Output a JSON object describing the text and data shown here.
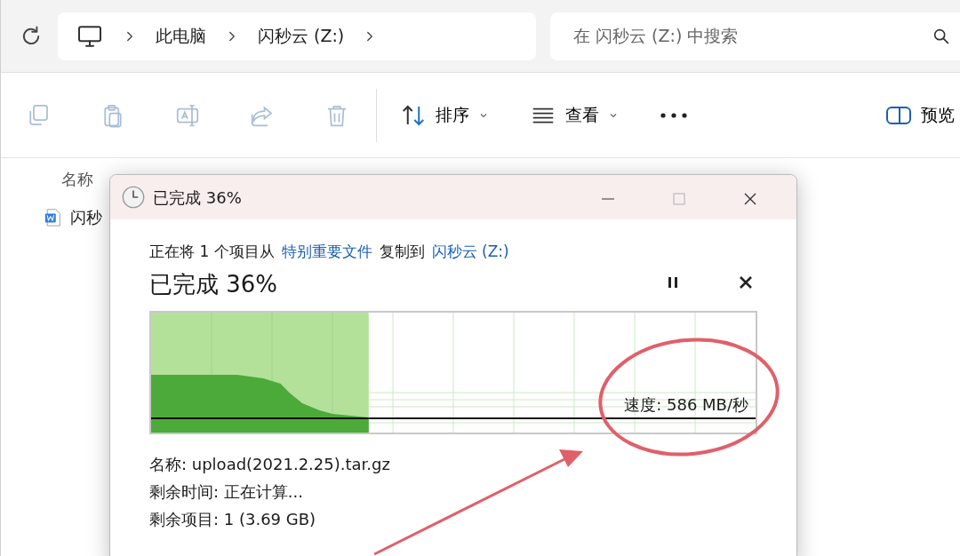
{
  "address_bar": {
    "breadcrumbs": [
      {
        "label": "此电脑"
      },
      {
        "label": "闪秒云 (Z:)"
      }
    ],
    "search": {
      "placeholder": "在 闪秒云 (Z:) 中搜索"
    }
  },
  "toolbar": {
    "icon_buttons": [
      {
        "kind": "copy",
        "disabled": true
      },
      {
        "kind": "paste",
        "disabled": true
      },
      {
        "kind": "rename",
        "disabled": true
      },
      {
        "kind": "share",
        "disabled": true
      },
      {
        "kind": "delete",
        "disabled": true
      }
    ],
    "menus": [
      {
        "kind": "sort",
        "label": "排序"
      },
      {
        "kind": "view",
        "label": "查看"
      }
    ],
    "preview": {
      "label": "预览"
    }
  },
  "file_list": {
    "columns": [
      {
        "label": "名称"
      }
    ],
    "rows": [
      {
        "name": "闪秒"
      }
    ]
  },
  "copy_dialog": {
    "title": "已完成 36%",
    "description": {
      "prefix": "正在将 1 个项目从",
      "source": "特别重要文件",
      "middle": "复制到",
      "destination": "闪秒云 (Z:)"
    },
    "heading": "已完成 36%",
    "progress": {
      "level": 0.36,
      "speed": "速度: 586 MB/秒"
    },
    "details": [
      "名称: upload(2021.2.25).tar.gz",
      "剩余时间: 正在计算...",
      "剩余项目: 1 (3.69 GB)"
    ]
  }
}
